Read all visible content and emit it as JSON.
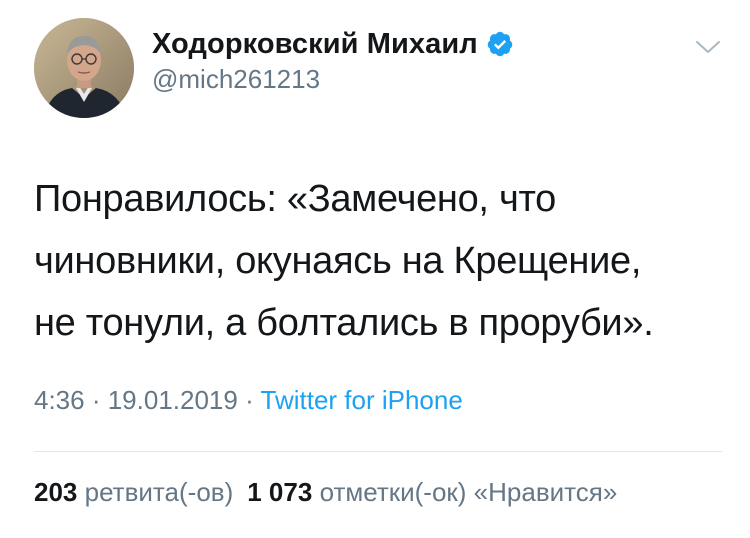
{
  "author": {
    "display_name": "Ходорковский Михаил",
    "handle": "@mich261213",
    "verified": true,
    "avatar_icon": "profile-photo"
  },
  "menu": {
    "icon": "chevron-down-icon"
  },
  "tweet": {
    "text": "Понравилось: «Замечено, что\nчиновники, окунаясь на Крещение,\nне тонули, а болтались в проруби»."
  },
  "meta": {
    "time": "4:36",
    "separator": " · ",
    "date": "19.01.2019",
    "source": "Twitter for iPhone"
  },
  "stats": {
    "retweets_count": "203",
    "retweets_label": "ретвита(-ов)",
    "likes_count": "1 073",
    "likes_label": "отметки(-ок) «Нравится»"
  },
  "colors": {
    "text": "#14171a",
    "secondary": "#657786",
    "accent": "#1da1f2",
    "divider": "#e1e8ed"
  }
}
